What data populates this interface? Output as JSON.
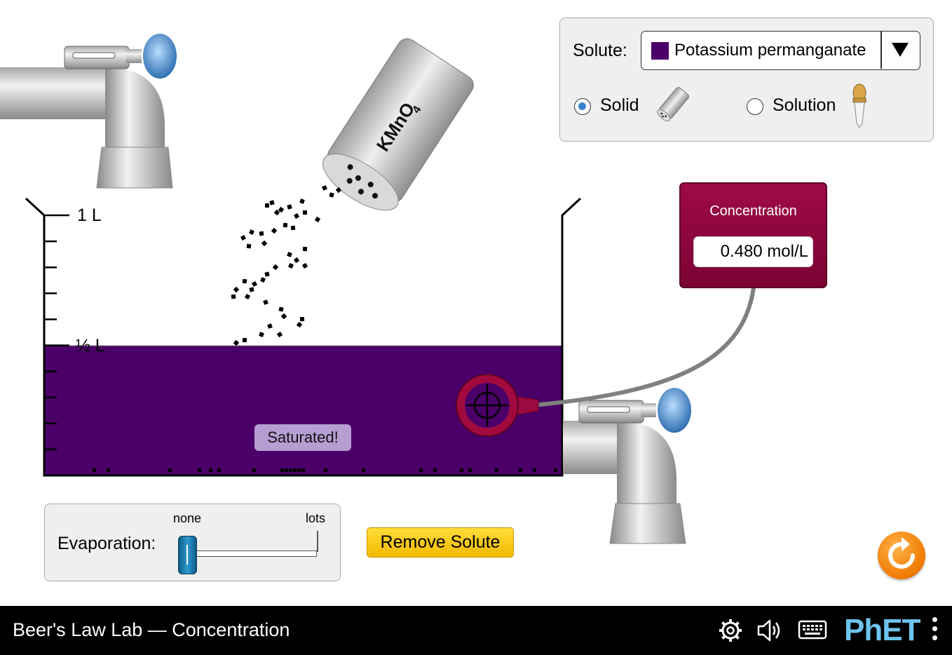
{
  "solute_panel": {
    "label": "Solute:",
    "selected": "Potassium permanganate",
    "swatch_color": "#4b0069",
    "form_options": [
      {
        "label": "Solid",
        "selected": true,
        "icon": "shaker-icon"
      },
      {
        "label": "Solution",
        "selected": false,
        "icon": "dropper-icon"
      }
    ]
  },
  "shaker": {
    "label": "KMnO",
    "subscript": "4"
  },
  "beaker": {
    "labels": {
      "full": "1 L",
      "half": "½ L"
    },
    "fill_fraction": 0.5,
    "solution_color": "#4b0069",
    "saturated_text": "Saturated!"
  },
  "concentration_meter": {
    "title": "Concentration",
    "value": "0.480 mol/L"
  },
  "evaporation": {
    "label": "Evaporation:",
    "min_label": "none",
    "max_label": "lots",
    "level": 0
  },
  "remove_solute": {
    "label": "Remove Solute"
  },
  "navbar": {
    "title": "Beer's Law Lab — Concentration",
    "logo": "PhET"
  },
  "colors": {
    "meter": "#8c0a3e",
    "button": "#f8c400",
    "reset": "#f58220",
    "liquid": "#4b0069"
  }
}
